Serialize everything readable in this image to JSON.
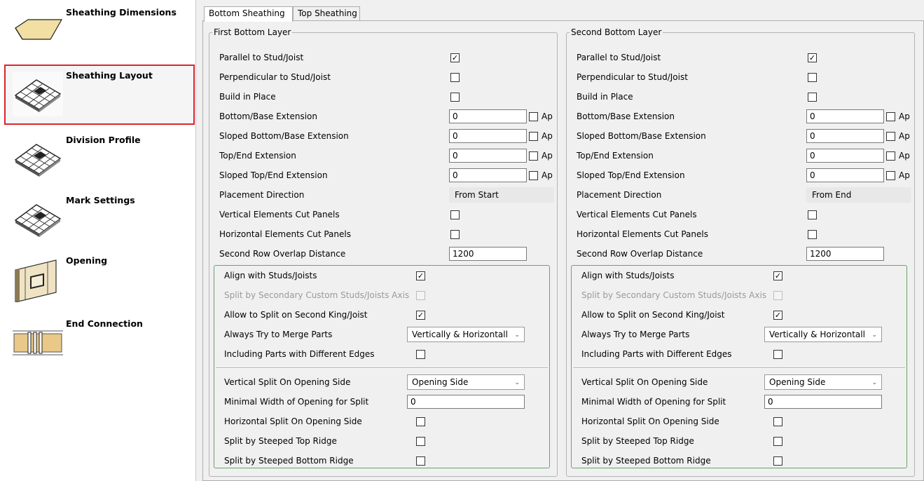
{
  "nav": {
    "items": [
      {
        "label": "Sheathing Dimensions",
        "icon": "sheathing-dimensions-icon",
        "selected": false
      },
      {
        "label": "Sheathing Layout",
        "icon": "sheathing-layout-icon",
        "selected": true
      },
      {
        "label": "Division Profile",
        "icon": "division-profile-icon",
        "selected": false
      },
      {
        "label": "Mark Settings",
        "icon": "mark-settings-icon",
        "selected": false
      },
      {
        "label": "Opening",
        "icon": "opening-icon",
        "selected": false
      },
      {
        "label": "End Connection",
        "icon": "end-connection-icon",
        "selected": false
      }
    ],
    "selected_border_color": "#d9262c"
  },
  "tabs": [
    {
      "label": "Bottom Sheathing",
      "active": true
    },
    {
      "label": "Top Sheathing",
      "active": false
    }
  ],
  "first_layer": {
    "title": "First Bottom Layer",
    "parallel": {
      "label": "Parallel to Stud/Joist",
      "checked": true
    },
    "perpendicular": {
      "label": "Perpendicular to Stud/Joist",
      "checked": false
    },
    "build_in_place": {
      "label": "Build in Place",
      "checked": false
    },
    "bottom_ext": {
      "label": "Bottom/Base Extension",
      "value": "0",
      "ap": "Ap"
    },
    "sloped_bottom_ext": {
      "label": "Sloped Bottom/Base Extension",
      "value": "0",
      "ap": "Ap"
    },
    "top_ext": {
      "label": "Top/End Extension",
      "value": "0",
      "ap": "Ap"
    },
    "sloped_top_ext": {
      "label": "Sloped Top/End Extension",
      "value": "0",
      "ap": "Ap"
    },
    "placement": {
      "label": "Placement Direction",
      "value": "From Start"
    },
    "vertical_cut": {
      "label": "Vertical Elements Cut Panels",
      "checked": false
    },
    "horizontal_cut": {
      "label": "Horizontal Elements Cut Panels",
      "checked": false
    },
    "overlap": {
      "label": "Second Row Overlap Distance",
      "value": "1200"
    },
    "align": {
      "label": "Align with Studs/Joists",
      "checked": true
    },
    "split_secondary": {
      "label": "Split by Secondary Custom Studs/Joists Axis",
      "checked": false
    },
    "allow_split": {
      "label": "Allow to Split on Second King/Joist",
      "checked": true
    },
    "merge": {
      "label": "Always Try to Merge Parts",
      "value": "Vertically & Horizontall"
    },
    "including": {
      "label": "Including Parts with Different Edges",
      "checked": false
    },
    "vertical_split": {
      "label": "Vertical Split On Opening Side",
      "value": "Opening Side"
    },
    "min_width": {
      "label": "Minimal Width of Opening for Split",
      "value": "0"
    },
    "horizontal_split": {
      "label": "Horizontal Split On Opening Side",
      "checked": false
    },
    "steeped_top": {
      "label": "Split by Steeped Top Ridge",
      "checked": false
    },
    "steeped_bottom": {
      "label": "Split by Steeped Bottom Ridge",
      "checked": false
    }
  },
  "second_layer": {
    "title": "Second Bottom Layer",
    "parallel": {
      "label": "Parallel to Stud/Joist",
      "checked": true
    },
    "perpendicular": {
      "label": "Perpendicular to Stud/Joist",
      "checked": false
    },
    "build_in_place": {
      "label": "Build in Place",
      "checked": false
    },
    "bottom_ext": {
      "label": "Bottom/Base Extension",
      "value": "0",
      "ap": "Ap"
    },
    "sloped_bottom_ext": {
      "label": "Sloped Bottom/Base Extension",
      "value": "0",
      "ap": "Ap"
    },
    "top_ext": {
      "label": "Top/End Extension",
      "value": "0",
      "ap": "Ap"
    },
    "sloped_top_ext": {
      "label": "Sloped Top/End Extension",
      "value": "0",
      "ap": "Ap"
    },
    "placement": {
      "label": "Placement Direction",
      "value": "From End"
    },
    "vertical_cut": {
      "label": "Vertical Elements Cut Panels",
      "checked": false
    },
    "horizontal_cut": {
      "label": "Horizontal Elements Cut Panels",
      "checked": false
    },
    "overlap": {
      "label": "Second Row Overlap Distance",
      "value": "1200"
    },
    "align": {
      "label": "Align with Studs/Joists",
      "checked": true
    },
    "split_secondary": {
      "label": "Split by Secondary Custom Studs/Joists Axis",
      "checked": false
    },
    "allow_split": {
      "label": "Allow to Split on Second King/Joist",
      "checked": true
    },
    "merge": {
      "label": "Always Try to Merge Parts",
      "value": "Vertically & Horizontall"
    },
    "including": {
      "label": "Including Parts with Different Edges",
      "checked": false
    },
    "vertical_split": {
      "label": "Vertical Split On Opening Side",
      "value": "Opening Side"
    },
    "min_width": {
      "label": "Minimal Width of Opening for Split",
      "value": "0"
    },
    "horizontal_split": {
      "label": "Horizontal Split On Opening Side",
      "checked": false
    },
    "steeped_top": {
      "label": "Split by Steeped Top Ridge",
      "checked": false
    },
    "steeped_bottom": {
      "label": "Split by Steeped Bottom Ridge",
      "checked": false
    }
  }
}
